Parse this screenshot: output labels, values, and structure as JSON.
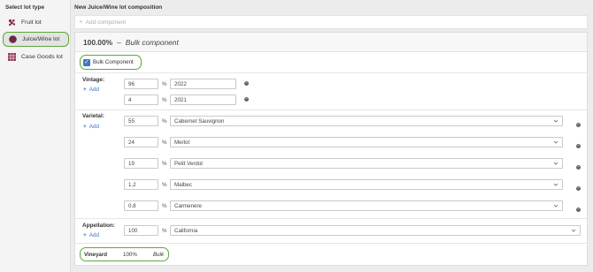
{
  "sidebar": {
    "title": "Select lot type",
    "items": [
      {
        "label": "Fruit lot",
        "icon": "grapes-icon"
      },
      {
        "label": "Juice/Wine lot",
        "icon": "wine-circle-icon"
      },
      {
        "label": "Case Goods lot",
        "icon": "case-grid-icon"
      }
    ],
    "active_index": 1
  },
  "main": {
    "title": "New Juice/Wine lot composition",
    "add_component_label": "Add component",
    "component": {
      "percent": "100.00%",
      "dash": "–",
      "type": "Bulk component",
      "bulk_checkbox_label": "Bulk Component",
      "bulk_checked": true
    },
    "vintage": {
      "label": "Vintage:",
      "add_label": "Add",
      "rows": [
        {
          "value": "96",
          "unit": "%",
          "name": "2022"
        },
        {
          "value": "4",
          "unit": "%",
          "name": "2021"
        }
      ]
    },
    "varietal": {
      "label": "Varietal:",
      "add_label": "Add",
      "rows": [
        {
          "value": "55",
          "unit": "%",
          "name": "Cabernet Sauvignon"
        },
        {
          "value": "24",
          "unit": "%",
          "name": "Merlot"
        },
        {
          "value": "19",
          "unit": "%",
          "name": "Petit Verdot"
        },
        {
          "value": "1.2",
          "unit": "%",
          "name": "Malbec"
        },
        {
          "value": "0.8",
          "unit": "%",
          "name": "Carmenere"
        }
      ]
    },
    "appellation": {
      "label": "Appellation:",
      "add_label": "Add",
      "rows": [
        {
          "value": "100",
          "unit": "%",
          "name": "California"
        }
      ]
    },
    "vineyard": {
      "name": "Vineyard",
      "percent": "100%",
      "kind": "Bulk"
    }
  },
  "colors": {
    "accent_green": "#5aa83a",
    "link_blue": "#3b78c2",
    "wine_purple": "#6b2a44"
  }
}
